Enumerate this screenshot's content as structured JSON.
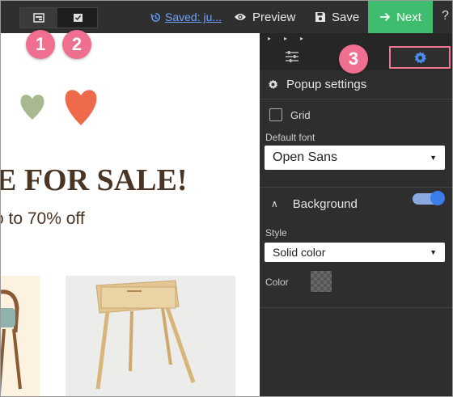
{
  "topbar": {
    "saved_label": "Saved: ju...",
    "preview_label": "Preview",
    "save_label": "Save",
    "next_label": "Next",
    "help_label": "?",
    "accent_color": "#3dbd6d",
    "link_color": "#6ea0ff",
    "mode_icons": [
      "layout-icon",
      "checkbox-icon"
    ]
  },
  "canvas": {
    "headline": "E FOR SALE!",
    "subline": "o to 70% off",
    "text_color": "#4a3424"
  },
  "panel": {
    "section_title": "Popup settings",
    "grid_label": "Grid",
    "grid_checked": false,
    "default_font_label": "Default font",
    "default_font_value": "Open Sans",
    "background_label": "Background",
    "background_enabled": true,
    "style_label": "Style",
    "style_value": "Solid color",
    "color_label": "Color",
    "tabs": [
      "sliders-icon",
      "gear-icon"
    ],
    "active_tab": "gear-icon"
  },
  "callouts": {
    "one": "1",
    "two": "2",
    "three": "3",
    "color": "#ef6f91",
    "highlight_color": "#f07593"
  }
}
